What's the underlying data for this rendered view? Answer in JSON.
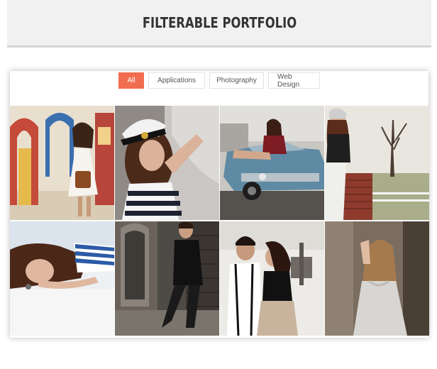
{
  "header": {
    "title": "FILTERABLE PORTFOLIO"
  },
  "filters": [
    {
      "label": "All",
      "active": true
    },
    {
      "label": "Applications",
      "active": false
    },
    {
      "label": "Photography",
      "active": false
    },
    {
      "label": "Web Design",
      "active": false
    }
  ],
  "tiles": [
    {
      "name": "woman-carnival-handbag-photo"
    },
    {
      "name": "woman-sailor-hat-photo"
    },
    {
      "name": "woman-on-vintage-car-photo"
    },
    {
      "name": "woman-by-brick-wall-photo"
    },
    {
      "name": "woman-lying-striped-top-photo"
    },
    {
      "name": "man-black-shirt-leaning-photo"
    },
    {
      "name": "couple-embracing-photo"
    },
    {
      "name": "woman-grey-sweater-photo"
    }
  ]
}
